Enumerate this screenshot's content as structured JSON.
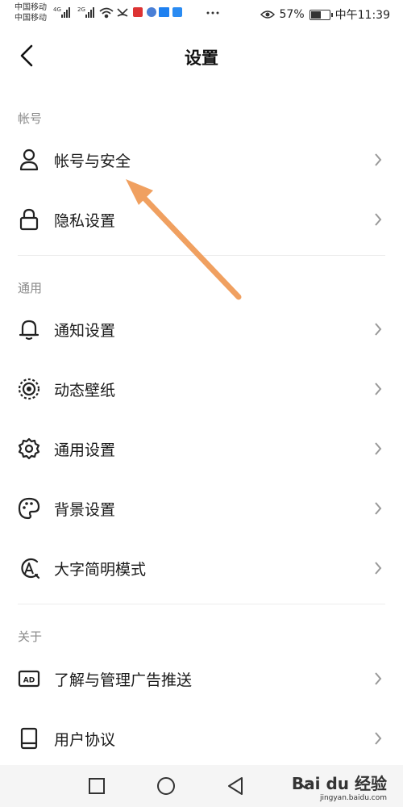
{
  "status_bar": {
    "carrier1": "中国移动",
    "carrier2": "中国移动",
    "net1": "4G",
    "net2": "2G",
    "battery_text": "57%",
    "battery_level": 0.57,
    "time": "中午11:39"
  },
  "header": {
    "title": "设置"
  },
  "sections": [
    {
      "label": "帐号",
      "items": [
        {
          "label": "帐号与安全",
          "icon": "person-icon"
        },
        {
          "label": "隐私设置",
          "icon": "lock-icon"
        }
      ]
    },
    {
      "label": "通用",
      "items": [
        {
          "label": "通知设置",
          "icon": "bell-icon"
        },
        {
          "label": "动态壁纸",
          "icon": "live-wallpaper-icon"
        },
        {
          "label": "通用设置",
          "icon": "gear-icon"
        },
        {
          "label": "背景设置",
          "icon": "palette-icon"
        },
        {
          "label": "大字简明模式",
          "icon": "large-text-icon"
        }
      ]
    },
    {
      "label": "关于",
      "items": [
        {
          "label": "了解与管理广告推送",
          "icon": "ad-icon"
        },
        {
          "label": "用户协议",
          "icon": "book-icon"
        }
      ]
    }
  ],
  "watermark": {
    "main": "Bai du 经验",
    "sub": "jingyan.baidu.com"
  },
  "colors": {
    "accent_arrow": "#f0a060",
    "section_label": "#8a8a8a"
  }
}
